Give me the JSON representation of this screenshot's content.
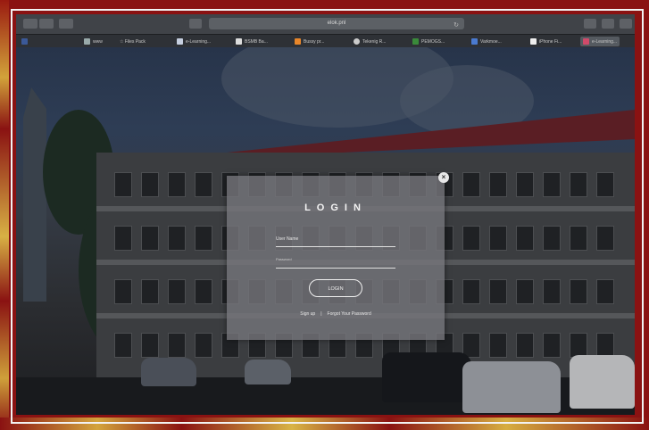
{
  "browser": {
    "address": "elok.pnl",
    "tabs": [
      {
        "label": "www"
      },
      {
        "label": "☆ Files Pack"
      },
      {
        "label": "e-Learning..."
      },
      {
        "label": "BSMB Ba..."
      },
      {
        "label": "Bussy pr..."
      },
      {
        "label": "Tekenig R..."
      },
      {
        "label": "PEMOGS..."
      },
      {
        "label": "Varkmoe..."
      },
      {
        "label": "iPhone Fi..."
      },
      {
        "label": "e-Learning..."
      }
    ]
  },
  "login": {
    "title": "LOGIN",
    "username_label": "User Name",
    "password_label": "Password",
    "button_label": "LOGIN",
    "signup_link": "Sign up",
    "separator": "|",
    "forgot_link": "Forgot Your Password"
  },
  "colors": {
    "frame": "#8a1212",
    "dialog": "#76767a"
  }
}
